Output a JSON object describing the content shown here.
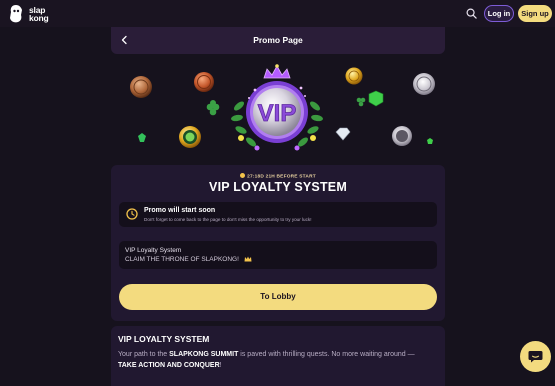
{
  "header": {
    "logo_text_line1": "slap",
    "logo_text_line2": "kong",
    "login_label": "Log in",
    "signup_label": "Sign up"
  },
  "promo_header": {
    "title": "Promo Page"
  },
  "hero": {
    "badge_text": "VIP"
  },
  "promo": {
    "timer": "27:18D 21H BEFORE START",
    "title": "VIP LOYALTY SYSTEM",
    "notice_title": "Promo will start soon",
    "notice_sub": "Don't forget to come back to the page to don't miss the opportunity to try your luck!",
    "desc_line1": "VIP Loyalty System",
    "desc_line2": "CLAIM THE THRONE OF SLAPKONG!",
    "cta_label": "To Lobby"
  },
  "details": {
    "title": "VIP LOYALTY SYSTEM",
    "text_1": "Your path to the ",
    "text_bold1": "SLAPKONG SUMMIT",
    "text_2": " is paved with thrilling quests. No more waiting around —",
    "text_bold2": "TAKE ACTION AND CONQUER",
    "text_3": "!"
  },
  "colors": {
    "background": "#16121d",
    "accent_yellow": "#f3db7f",
    "accent_purple": "#7d5cd6",
    "card": "#211830"
  },
  "icons": [
    "kong-logo-icon",
    "search-icon",
    "chevron-left-icon",
    "clock-icon",
    "crown-icon",
    "chat-icon"
  ]
}
